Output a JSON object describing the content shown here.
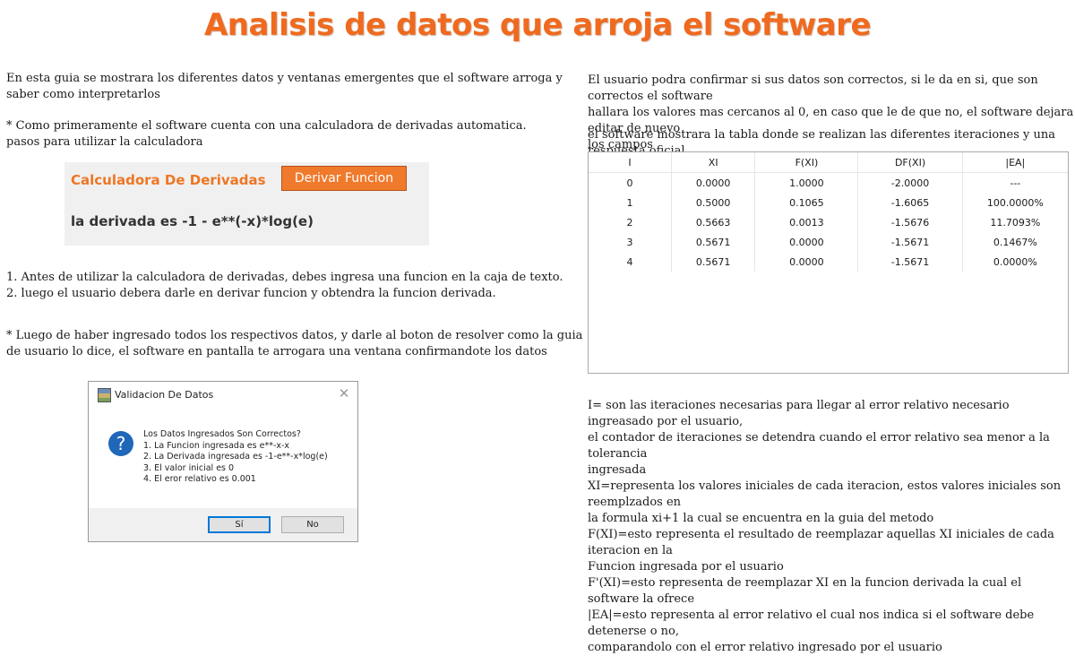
{
  "title": "Analisis de datos que arroja el software",
  "left": {
    "intro": [
      "En esta guia se mostrara los diferentes datos y ventanas emergentes que el software arroga y",
      "saber como interpretarlos"
    ],
    "calc_intro": [
      "* Como primeramente el software cuenta con una calculadora de derivadas automatica.",
      "pasos para utilizar la calculadora"
    ],
    "calculator": {
      "title": "Calculadora De Derivadas",
      "button_label": "Derivar Funcion",
      "result": "la derivada es -1 - e**(-x)*log(e)"
    },
    "steps": [
      "1. Antes de utilizar la calculadora de derivadas, debes ingresa una funcion en la caja de texto.",
      "2. luego el usuario debera darle en derivar funcion y obtendra la funcion derivada."
    ],
    "resolve_text": [
      "* Luego de haber ingresado todos los respectivos datos, y darle al boton de resolver como la guia",
      "de usuario lo dice, el software en pantalla te arrogara una ventana confirmandote los datos"
    ],
    "dialog": {
      "title": "Validacion De Datos",
      "close": "✕",
      "question_glyph": "?",
      "lines": [
        "Los Datos Ingresados Son Correctos?",
        "1. La Funcion ingresada es e**-x-x",
        "2. La Derivada ingresada es -1-e**-x*log(e)",
        "3. El valor inicial es 0",
        "4. El eror relativo es 0.001"
      ],
      "yes_label": "Sí",
      "no_label": "No"
    }
  },
  "right": {
    "confirm_text": [
      "El usuario podra confirmar si sus datos son correctos, si le da en si, que son correctos el software",
      "hallara los valores mas cercanos al 0, en caso que le de que no, el software dejara editar de nuevo",
      "los campos"
    ],
    "table_intro": "el software mostrara la tabla donde se realizan las diferentes iteraciones y una respuesta oficial",
    "table": {
      "headers": [
        "I",
        "XI",
        "F(XI)",
        "DF(XI)",
        "|EA|"
      ],
      "rows": [
        [
          "0",
          "0.0000",
          "1.0000",
          "-2.0000",
          "---"
        ],
        [
          "1",
          "0.5000",
          "0.1065",
          "-1.6065",
          "100.0000%"
        ],
        [
          "2",
          "0.5663",
          "0.0013",
          "-1.5676",
          "11.7093%"
        ],
        [
          "3",
          "0.5671",
          "0.0000",
          "-1.5671",
          "0.1467%"
        ],
        [
          "4",
          "0.5671",
          "0.0000",
          "-1.5671",
          "0.0000%"
        ]
      ]
    },
    "explanation": [
      "I= son las iteraciones necesarias para llegar al error relativo necesario ingreasado por el usuario,",
      "el contador de iteraciones se detendra cuando el error relativo sea menor a la tolerancia",
      "ingresada",
      "XI=representa los valores iniciales de cada iteracion, estos valores iniciales son reemplzados en",
      "la formula xi+1 la cual se encuentra en la guia del metodo",
      "F(XI)=esto representa el resultado de reemplazar aquellas XI iniciales de cada iteracion en la",
      "Funcion ingresada por el usuario",
      "F'(XI)=esto representa de reemplazar XI en la funcion derivada la cual el software la ofrece",
      "|EA|=esto representa al error relativo el cual nos indica si el software debe detenerse o no,",
      "comparandolo con el error relativo ingresado por el usuario"
    ]
  }
}
